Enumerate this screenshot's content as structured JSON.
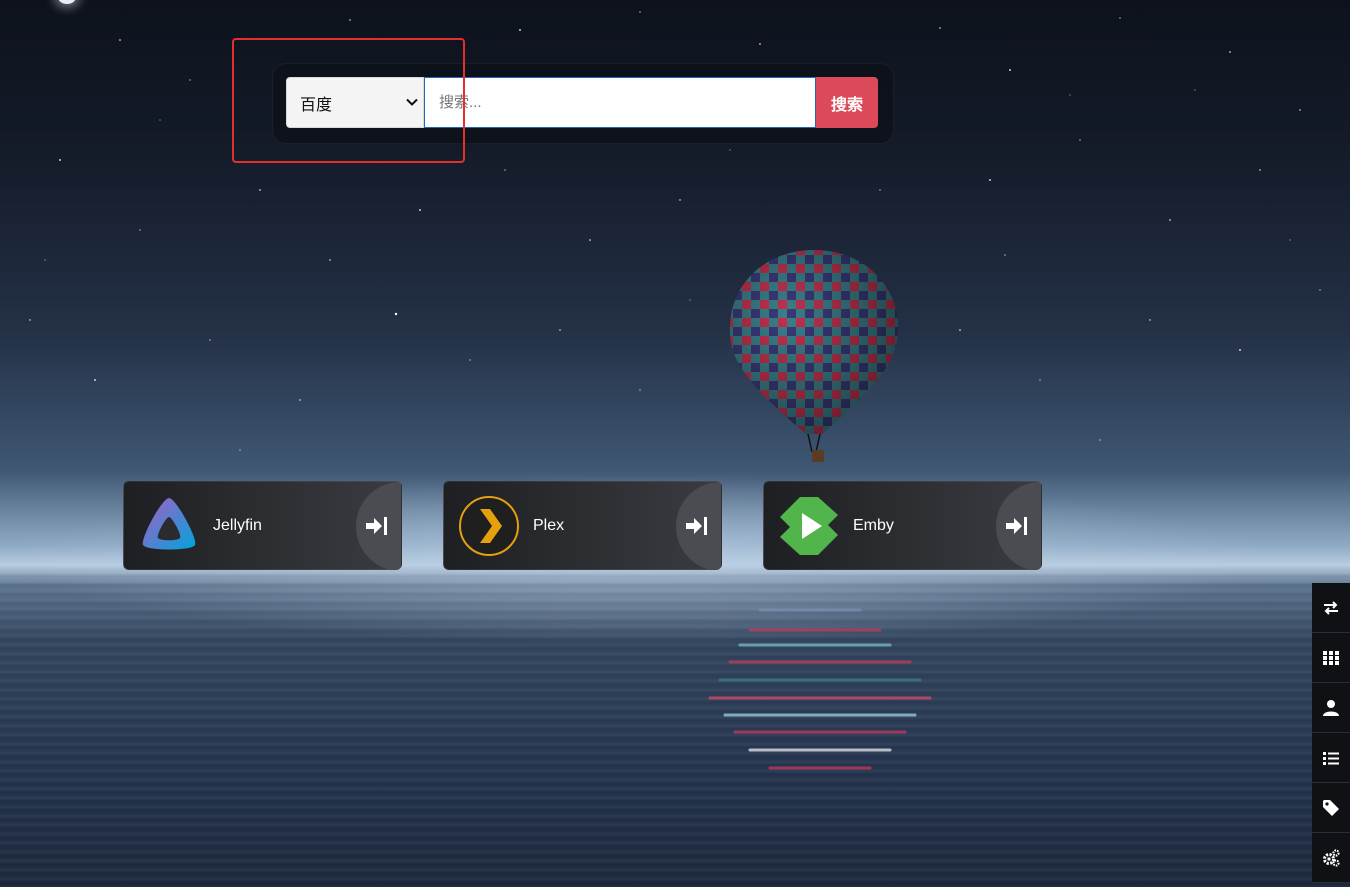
{
  "search": {
    "engine_selected": "百度",
    "input_placeholder": "搜索...",
    "input_value": "",
    "button_label": "搜索"
  },
  "apps": [
    {
      "name": "Jellyfin",
      "icon": "jellyfin-logo-icon"
    },
    {
      "name": "Plex",
      "icon": "plex-logo-icon"
    },
    {
      "name": "Emby",
      "icon": "emby-logo-icon"
    }
  ],
  "toolbar": [
    {
      "icon": "swap-arrows-icon"
    },
    {
      "icon": "grid-icon"
    },
    {
      "icon": "user-icon"
    },
    {
      "icon": "list-icon"
    },
    {
      "icon": "tag-icon"
    },
    {
      "icon": "cogs-icon"
    }
  ],
  "colors": {
    "search_button": "#dc4a59",
    "highlight_box": "#e2302c",
    "input_border": "#2566b8"
  }
}
